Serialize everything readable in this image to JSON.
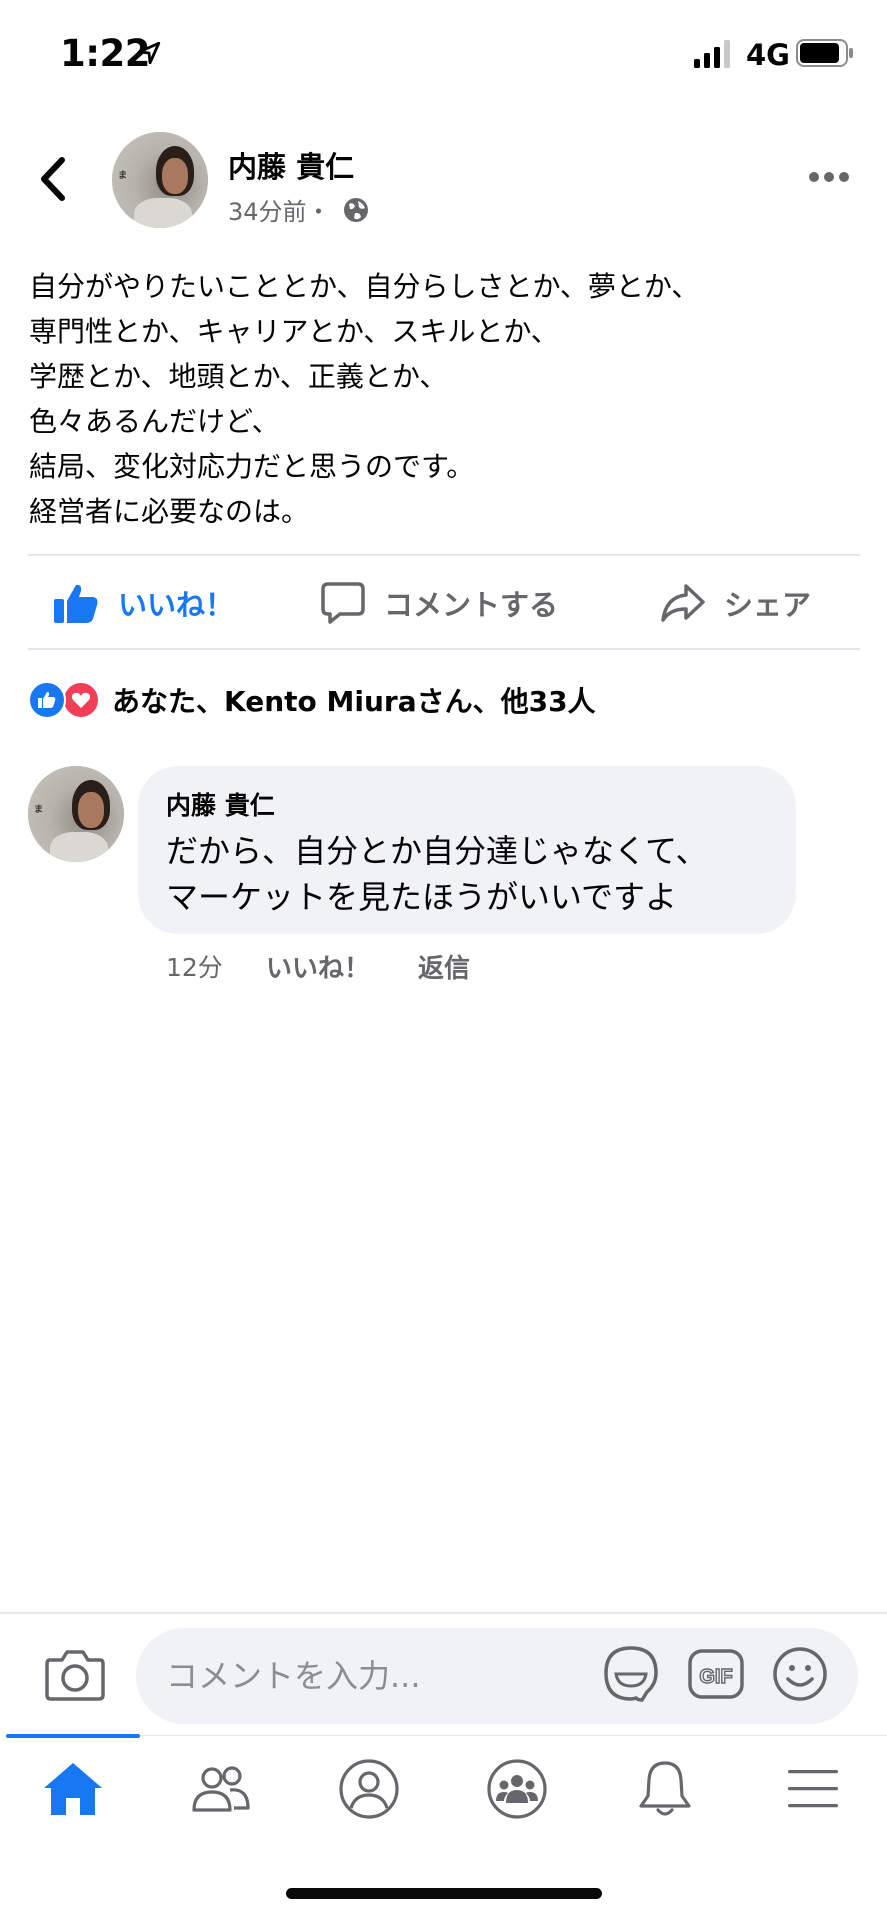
{
  "status_bar": {
    "time": "1:22",
    "network": "4G",
    "location_icon": "location-arrow-icon",
    "signal_icon": "cellular-signal-icon",
    "battery_icon": "battery-icon"
  },
  "post": {
    "author": "内藤 貴仁",
    "time": "34分前・",
    "privacy_icon": "globe-icon",
    "body_lines": [
      "自分がやりたいこととか、自分らしさとか、夢とか、",
      "専門性とか、キャリアとか、スキルとか、",
      "学歴とか、地頭とか、正義とか、",
      "色々あるんだけど、",
      "結局、変化対応力だと思うのです。",
      "経営者に必要なのは。"
    ]
  },
  "actions": {
    "like": "いいね！",
    "comment": "コメントする",
    "share": "シェア"
  },
  "reactions": {
    "summary": "あなた、Kento Miuraさん、他33人"
  },
  "comment": {
    "author": "内藤 貴仁",
    "lines": [
      "だから、自分とか自分達じゃなくて、",
      "マーケットを見たほうがいいですよ"
    ],
    "time": "12分",
    "like": "いいね！",
    "reply": "返信"
  },
  "composer": {
    "placeholder": "コメントを入力..."
  },
  "nav": {
    "items": [
      "home-icon",
      "friends-icon",
      "profile-icon",
      "groups-icon",
      "notifications-bell-icon",
      "menu-icon"
    ],
    "active": "home-icon"
  },
  "colors": {
    "accent": "#1877f2",
    "muted_text": "#65676b",
    "bubble_bg": "#f0f2f5",
    "love": "#f33e58"
  }
}
